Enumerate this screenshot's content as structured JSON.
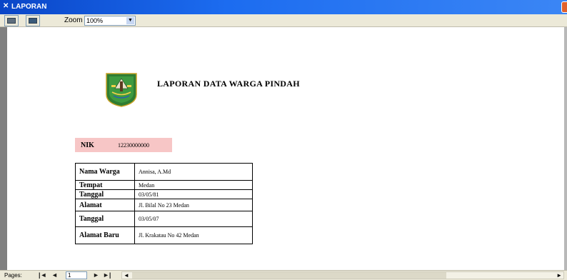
{
  "window": {
    "title": "LAPORAN",
    "app_icon": "app-icon"
  },
  "toolbar": {
    "print_icon": "printer-icon",
    "export_icon": "export-icon",
    "zoom_label": "Zoom",
    "zoom_value": "100%"
  },
  "report": {
    "logo_icon": "provincial-emblem",
    "title": "LAPORAN DATA WARGA PINDAH",
    "nik_label": "NIK",
    "nik_value": "12230000000",
    "rows": [
      {
        "label": "Nama Warga",
        "value": "Annisa, A.Md"
      },
      {
        "label": "Tempat",
        "value": "Medan"
      },
      {
        "label": "Tanggal",
        "value": "03/05/81"
      },
      {
        "label": "Alamat",
        "value": "Jl. Bilal No 23 Medan"
      },
      {
        "label": "Tanggal",
        "value": "03/05/07"
      },
      {
        "label": "Alamat Baru",
        "value": "Jl. Krakatau No 42 Medan"
      }
    ]
  },
  "statusbar": {
    "pages_label": "Pages:",
    "page_value": "1"
  },
  "colors": {
    "title_bar": "#1c6cf0",
    "nik_highlight": "#f7c6c6",
    "gutter": "#808080"
  }
}
